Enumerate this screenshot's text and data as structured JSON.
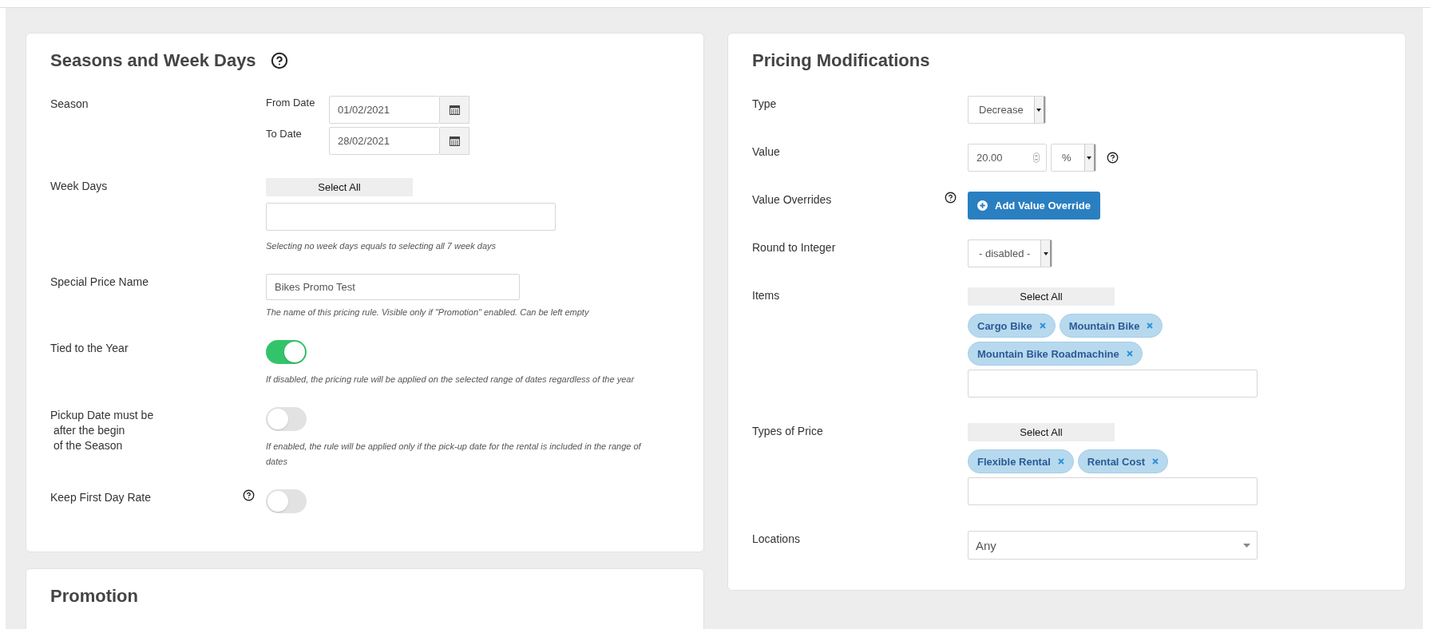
{
  "left_panel": {
    "title": "Seasons and Week Days",
    "title_help": true,
    "fields": [
      {
        "kind": "date_range",
        "label": "Season",
        "from_label": "From Date",
        "from_value": "01/02/2021",
        "to_label": "To Date",
        "to_value": "28/02/2021"
      },
      {
        "kind": "multiselect",
        "label": "Week Days",
        "select_all": "Select All",
        "hint": "Selecting no week days equals to selecting all 7 week days"
      },
      {
        "kind": "text",
        "label": "Special Price Name",
        "value": "Bikes Promo Test",
        "hint": "The name of this pricing rule. Visible only if \"Promotion\" enabled. Can be left empty"
      },
      {
        "kind": "toggle",
        "label": "Tied to the Year",
        "on": true,
        "hint": "If disabled, the pricing rule will be applied on the selected range of dates regardless of the year"
      },
      {
        "kind": "toggle",
        "label": "Pickup Date must be\n after the begin\n of the Season",
        "on": false,
        "hint": "If enabled, the rule will be applied only if the pick-up date for the rental is included in the range of dates"
      },
      {
        "kind": "toggle",
        "label": "Keep First Day Rate",
        "on": false,
        "help": true
      }
    ]
  },
  "promotion_panel": {
    "title": "Promotion"
  },
  "right_panel": {
    "title": "Pricing Modifications",
    "fields": [
      {
        "kind": "select",
        "label": "Type",
        "value": "Decrease"
      },
      {
        "kind": "number_unit",
        "label": "Value",
        "value": "20.00",
        "unit": "%",
        "help": true
      },
      {
        "kind": "button",
        "label": "Value Overrides",
        "button": "Add Value Override",
        "help": true
      },
      {
        "kind": "select",
        "label": "Round to Integer",
        "value": "- disabled -"
      },
      {
        "kind": "multiselect",
        "label": "Items",
        "select_all": "Select All",
        "tags": [
          "Cargo Bike",
          "Mountain Bike",
          "Mountain Bike Roadmachine"
        ]
      },
      {
        "kind": "multiselect",
        "label": "Types of Price",
        "select_all": "Select All",
        "tags": [
          "Flexible Rental",
          "Rental Cost"
        ]
      },
      {
        "kind": "dropdown",
        "label": "Locations",
        "value": "Any"
      }
    ]
  }
}
